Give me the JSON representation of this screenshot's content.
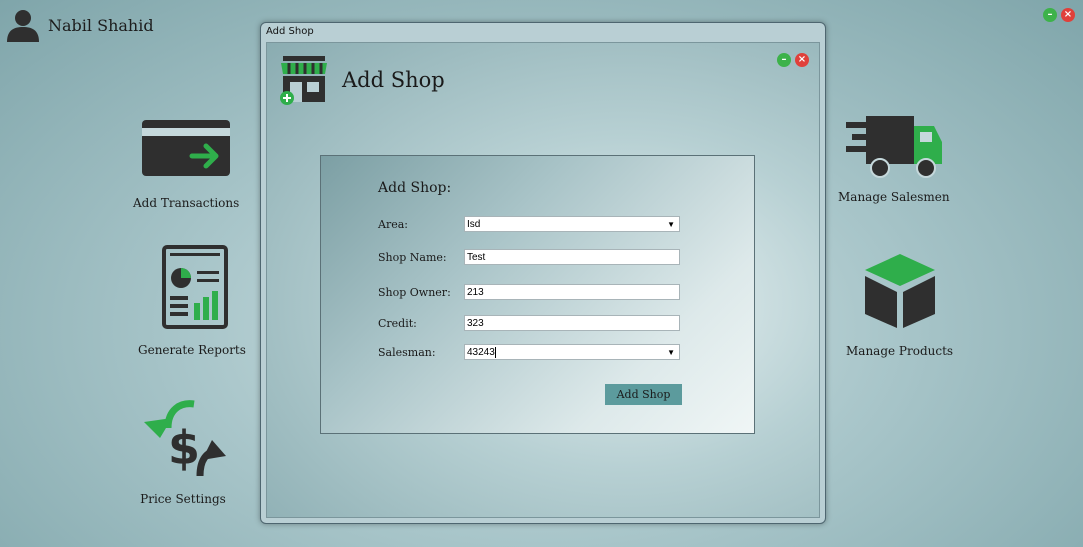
{
  "user": {
    "name": "Nabil Shahid"
  },
  "dashboard": {
    "tiles": [
      {
        "label": "Add Transactions",
        "icon": "card-arrow-icon"
      },
      {
        "label": "Generate Reports",
        "icon": "report-icon"
      },
      {
        "label": "Price Settings",
        "icon": "dollar-arrows-icon"
      },
      {
        "label": "Manage Salesmen",
        "icon": "truck-icon"
      },
      {
        "label": "Manage Products",
        "icon": "box-icon"
      }
    ]
  },
  "window": {
    "title": "Add Shop",
    "heading": "Add Shop"
  },
  "form": {
    "title": "Add Shop:",
    "fields": [
      {
        "label": "Area:",
        "value": "Isd",
        "type": "select"
      },
      {
        "label": "Shop Name:",
        "value": "Test",
        "type": "text"
      },
      {
        "label": "Shop Owner:",
        "value": "213",
        "type": "text"
      },
      {
        "label": "Credit:",
        "value": "323",
        "type": "text"
      },
      {
        "label": "Salesman:",
        "value": "43243",
        "type": "select"
      }
    ],
    "submit_label": "Add Shop"
  },
  "colors": {
    "accent_green": "#3db24a",
    "close_red": "#e0403a",
    "button_teal": "#5c9b9d",
    "icon_dark": "#2f2f2f"
  }
}
